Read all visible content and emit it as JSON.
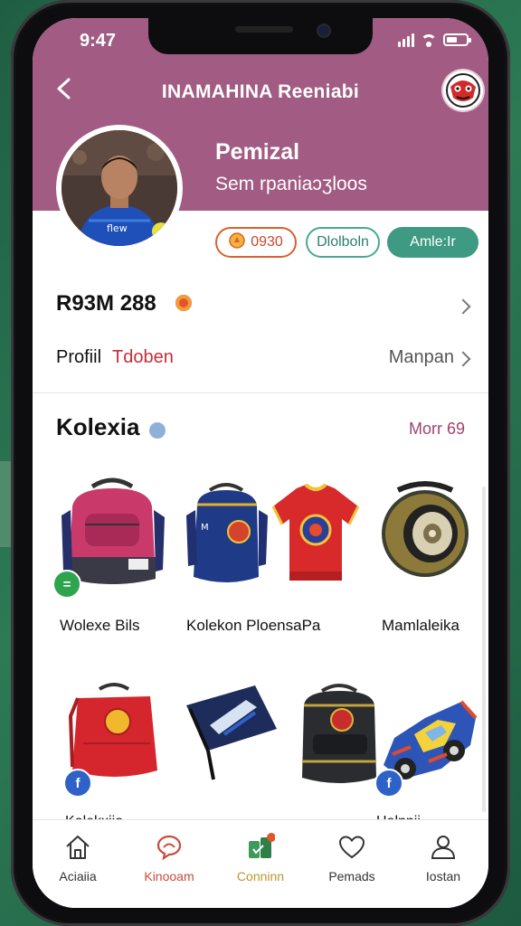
{
  "status": {
    "time": "9:47",
    "battery_level": 0.55
  },
  "header": {
    "title": "INAMAHINA Reeniabi",
    "back_icon": "arrow-left-icon",
    "logo_icon": "team-crest-icon"
  },
  "profile": {
    "name": "Pemizal",
    "subtitle": "Sem rpaniaɔʒloos"
  },
  "chips": [
    {
      "label": "0930",
      "icon": "coin-icon",
      "color": "#d9602f"
    },
    {
      "label": "Dlolboln",
      "color": "#48a892"
    },
    {
      "label": "Amle:Ir",
      "color": "#3e9a82"
    }
  ],
  "stats": {
    "value": "R93M 288"
  },
  "profile_link": {
    "label": "Profiil",
    "label_accent": "Tdoben",
    "action": "Manpan"
  },
  "collection": {
    "title": "Kolexia",
    "more": "Morr 69",
    "items_row1": [
      {
        "name": "Wolexe Bils",
        "icon": "backpack-icon"
      },
      {
        "name": "Kolekon PloensaPa",
        "icon": "jersey-icon"
      },
      {
        "name": "Mamlaleika",
        "icon": "speaker-icon"
      }
    ],
    "items_row2": [
      {
        "icon": "red-bag-icon"
      },
      {
        "icon": "flag-icon"
      },
      {
        "icon": "dark-backpack-icon"
      },
      {
        "icon": "toy-car-icon"
      }
    ],
    "partial_labels": [
      "Kolekxiio",
      "Holnpii"
    ]
  },
  "nav": [
    {
      "label": "Aciaiia",
      "icon": "home-icon",
      "color": "#333333"
    },
    {
      "label": "Kinooam",
      "icon": "chat-icon",
      "color": "#c94a3c"
    },
    {
      "label": "Conninn",
      "icon": "shop-icon",
      "color": "#3e9a5a"
    },
    {
      "label": "Pemads",
      "icon": "heart-icon",
      "color": "#333333"
    },
    {
      "label": "Iostan",
      "icon": "user-icon",
      "color": "#333333"
    }
  ],
  "colors": {
    "header": "#a25c83",
    "accent_green": "#3e9a82",
    "accent_red": "#d9602f"
  }
}
